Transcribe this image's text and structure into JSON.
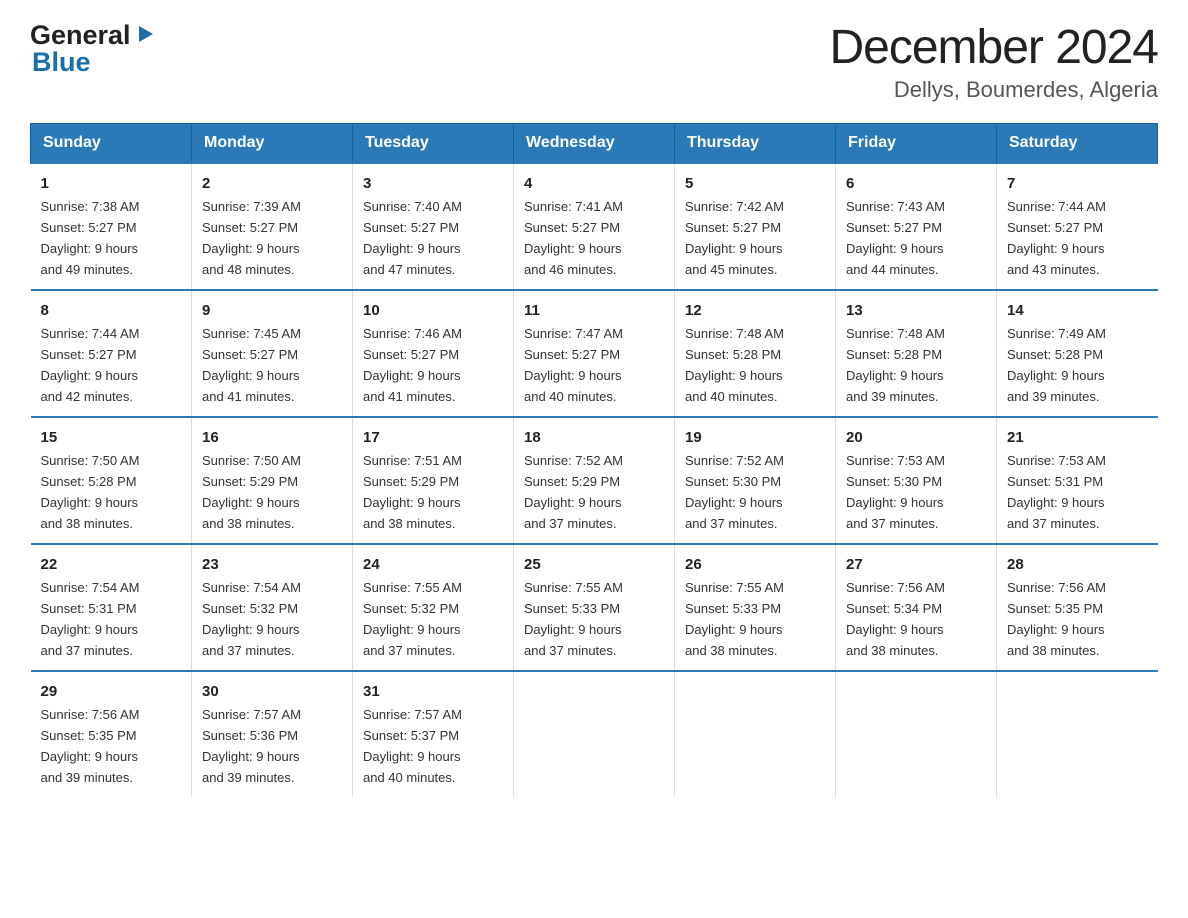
{
  "logo": {
    "line1": "General",
    "line2": "Blue"
  },
  "header": {
    "month": "December 2024",
    "location": "Dellys, Boumerdes, Algeria"
  },
  "weekdays": [
    "Sunday",
    "Monday",
    "Tuesday",
    "Wednesday",
    "Thursday",
    "Friday",
    "Saturday"
  ],
  "weeks": [
    [
      {
        "day": "1",
        "sunrise": "7:38 AM",
        "sunset": "5:27 PM",
        "daylight": "9 hours and 49 minutes."
      },
      {
        "day": "2",
        "sunrise": "7:39 AM",
        "sunset": "5:27 PM",
        "daylight": "9 hours and 48 minutes."
      },
      {
        "day": "3",
        "sunrise": "7:40 AM",
        "sunset": "5:27 PM",
        "daylight": "9 hours and 47 minutes."
      },
      {
        "day": "4",
        "sunrise": "7:41 AM",
        "sunset": "5:27 PM",
        "daylight": "9 hours and 46 minutes."
      },
      {
        "day": "5",
        "sunrise": "7:42 AM",
        "sunset": "5:27 PM",
        "daylight": "9 hours and 45 minutes."
      },
      {
        "day": "6",
        "sunrise": "7:43 AM",
        "sunset": "5:27 PM",
        "daylight": "9 hours and 44 minutes."
      },
      {
        "day": "7",
        "sunrise": "7:44 AM",
        "sunset": "5:27 PM",
        "daylight": "9 hours and 43 minutes."
      }
    ],
    [
      {
        "day": "8",
        "sunrise": "7:44 AM",
        "sunset": "5:27 PM",
        "daylight": "9 hours and 42 minutes."
      },
      {
        "day": "9",
        "sunrise": "7:45 AM",
        "sunset": "5:27 PM",
        "daylight": "9 hours and 41 minutes."
      },
      {
        "day": "10",
        "sunrise": "7:46 AM",
        "sunset": "5:27 PM",
        "daylight": "9 hours and 41 minutes."
      },
      {
        "day": "11",
        "sunrise": "7:47 AM",
        "sunset": "5:27 PM",
        "daylight": "9 hours and 40 minutes."
      },
      {
        "day": "12",
        "sunrise": "7:48 AM",
        "sunset": "5:28 PM",
        "daylight": "9 hours and 40 minutes."
      },
      {
        "day": "13",
        "sunrise": "7:48 AM",
        "sunset": "5:28 PM",
        "daylight": "9 hours and 39 minutes."
      },
      {
        "day": "14",
        "sunrise": "7:49 AM",
        "sunset": "5:28 PM",
        "daylight": "9 hours and 39 minutes."
      }
    ],
    [
      {
        "day": "15",
        "sunrise": "7:50 AM",
        "sunset": "5:28 PM",
        "daylight": "9 hours and 38 minutes."
      },
      {
        "day": "16",
        "sunrise": "7:50 AM",
        "sunset": "5:29 PM",
        "daylight": "9 hours and 38 minutes."
      },
      {
        "day": "17",
        "sunrise": "7:51 AM",
        "sunset": "5:29 PM",
        "daylight": "9 hours and 38 minutes."
      },
      {
        "day": "18",
        "sunrise": "7:52 AM",
        "sunset": "5:29 PM",
        "daylight": "9 hours and 37 minutes."
      },
      {
        "day": "19",
        "sunrise": "7:52 AM",
        "sunset": "5:30 PM",
        "daylight": "9 hours and 37 minutes."
      },
      {
        "day": "20",
        "sunrise": "7:53 AM",
        "sunset": "5:30 PM",
        "daylight": "9 hours and 37 minutes."
      },
      {
        "day": "21",
        "sunrise": "7:53 AM",
        "sunset": "5:31 PM",
        "daylight": "9 hours and 37 minutes."
      }
    ],
    [
      {
        "day": "22",
        "sunrise": "7:54 AM",
        "sunset": "5:31 PM",
        "daylight": "9 hours and 37 minutes."
      },
      {
        "day": "23",
        "sunrise": "7:54 AM",
        "sunset": "5:32 PM",
        "daylight": "9 hours and 37 minutes."
      },
      {
        "day": "24",
        "sunrise": "7:55 AM",
        "sunset": "5:32 PM",
        "daylight": "9 hours and 37 minutes."
      },
      {
        "day": "25",
        "sunrise": "7:55 AM",
        "sunset": "5:33 PM",
        "daylight": "9 hours and 37 minutes."
      },
      {
        "day": "26",
        "sunrise": "7:55 AM",
        "sunset": "5:33 PM",
        "daylight": "9 hours and 38 minutes."
      },
      {
        "day": "27",
        "sunrise": "7:56 AM",
        "sunset": "5:34 PM",
        "daylight": "9 hours and 38 minutes."
      },
      {
        "day": "28",
        "sunrise": "7:56 AM",
        "sunset": "5:35 PM",
        "daylight": "9 hours and 38 minutes."
      }
    ],
    [
      {
        "day": "29",
        "sunrise": "7:56 AM",
        "sunset": "5:35 PM",
        "daylight": "9 hours and 39 minutes."
      },
      {
        "day": "30",
        "sunrise": "7:57 AM",
        "sunset": "5:36 PM",
        "daylight": "9 hours and 39 minutes."
      },
      {
        "day": "31",
        "sunrise": "7:57 AM",
        "sunset": "5:37 PM",
        "daylight": "9 hours and 40 minutes."
      },
      null,
      null,
      null,
      null
    ]
  ],
  "labels": {
    "sunrise": "Sunrise:",
    "sunset": "Sunset:",
    "daylight": "Daylight:"
  }
}
